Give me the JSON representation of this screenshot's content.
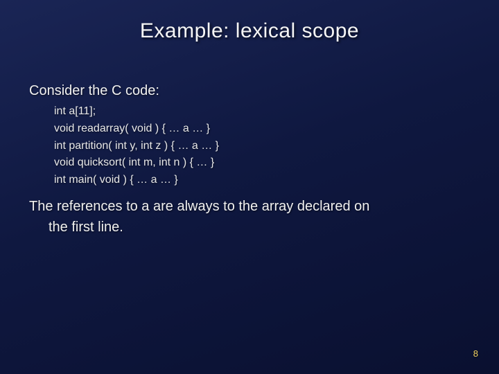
{
  "title": "Example: lexical scope",
  "intro": "Consider the C code:",
  "code": [
    "int a[11];",
    "void readarray( void ) { … a … }",
    "int partition( int y, int z ) { … a … }",
    "void quicksort( int m, int n ) { … }",
    "int main( void ) { … a … }"
  ],
  "outro_line1": "The references to a are always to the array declared on",
  "outro_line2": "the first line.",
  "page_number": "8"
}
